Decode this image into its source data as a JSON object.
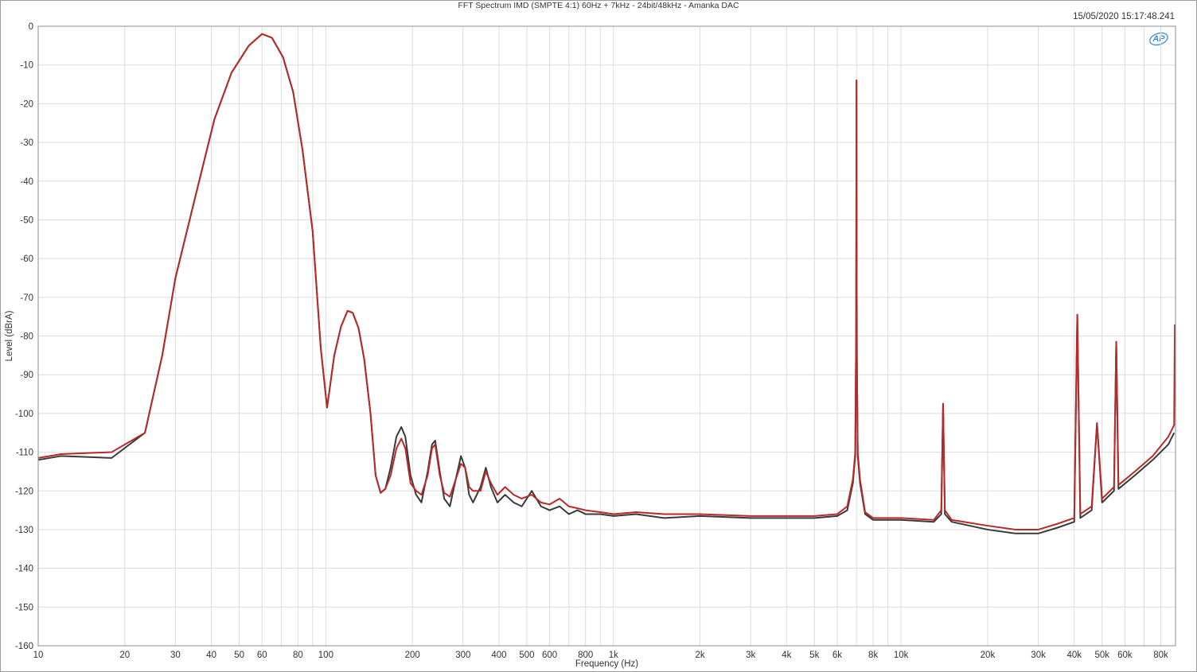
{
  "header": {
    "title": "FFT Spectrum IMD (SMPTE 4:1) 60Hz + 7kHz - 24bit/48kHz - Amanka DAC",
    "timestamp": "15/05/2020 15:17:48.241",
    "logo_text": "AP"
  },
  "chart_data": {
    "type": "line",
    "title": "FFT Spectrum IMD (SMPTE 4:1) 60Hz + 7kHz - 24bit/48kHz - Amanka DAC",
    "xlabel": "Frequency (Hz)",
    "ylabel": "Level (dBrA)",
    "x_scale": "log",
    "xlim": [
      10,
      90000
    ],
    "ylim": [
      -160,
      0
    ],
    "grid": true,
    "x_ticks": [
      {
        "value": 10,
        "label": "10"
      },
      {
        "value": 20,
        "label": "20"
      },
      {
        "value": 30,
        "label": "30"
      },
      {
        "value": 40,
        "label": "40"
      },
      {
        "value": 50,
        "label": "50"
      },
      {
        "value": 60,
        "label": "60"
      },
      {
        "value": 80,
        "label": "80"
      },
      {
        "value": 100,
        "label": "100"
      },
      {
        "value": 200,
        "label": "200"
      },
      {
        "value": 300,
        "label": "300"
      },
      {
        "value": 400,
        "label": "400"
      },
      {
        "value": 500,
        "label": "500"
      },
      {
        "value": 600,
        "label": "600"
      },
      {
        "value": 800,
        "label": "800"
      },
      {
        "value": 1000,
        "label": "1k"
      },
      {
        "value": 2000,
        "label": "2k"
      },
      {
        "value": 3000,
        "label": "3k"
      },
      {
        "value": 4000,
        "label": "4k"
      },
      {
        "value": 5000,
        "label": "5k"
      },
      {
        "value": 6000,
        "label": "6k"
      },
      {
        "value": 8000,
        "label": "8k"
      },
      {
        "value": 10000,
        "label": "10k"
      },
      {
        "value": 20000,
        "label": "20k"
      },
      {
        "value": 30000,
        "label": "30k"
      },
      {
        "value": 40000,
        "label": "40k"
      },
      {
        "value": 50000,
        "label": "50k"
      },
      {
        "value": 60000,
        "label": "60k"
      },
      {
        "value": 80000,
        "label": "80k"
      }
    ],
    "y_ticks": [
      0,
      -10,
      -20,
      -30,
      -40,
      -50,
      -60,
      -70,
      -80,
      -90,
      -100,
      -110,
      -120,
      -130,
      -140,
      -150,
      -160
    ],
    "series": [
      {
        "color": "#3a3a3a",
        "points": [
          [
            10,
            -112
          ],
          [
            12,
            -111
          ],
          [
            18,
            -111.5
          ],
          [
            23.5,
            -105
          ],
          [
            27,
            -85
          ],
          [
            30,
            -65
          ],
          [
            36,
            -41
          ],
          [
            41,
            -24
          ],
          [
            47,
            -12
          ],
          [
            54,
            -5
          ],
          [
            60,
            -2
          ],
          [
            65,
            -3
          ],
          [
            71,
            -8
          ],
          [
            77,
            -17
          ],
          [
            83,
            -32
          ],
          [
            90,
            -53
          ],
          [
            96,
            -83
          ],
          [
            101,
            -98.5
          ],
          [
            107,
            -85
          ],
          [
            113,
            -77.5
          ],
          [
            119,
            -73.5
          ],
          [
            124,
            -74
          ],
          [
            130,
            -78
          ],
          [
            136,
            -86
          ],
          [
            143,
            -100
          ],
          [
            149,
            -116
          ],
          [
            155,
            -120.5
          ],
          [
            161,
            -119.5
          ],
          [
            168,
            -114
          ],
          [
            176,
            -106
          ],
          [
            183,
            -103.5
          ],
          [
            189,
            -106
          ],
          [
            197,
            -116
          ],
          [
            206,
            -121
          ],
          [
            215,
            -123
          ],
          [
            226,
            -115
          ],
          [
            234,
            -108
          ],
          [
            240,
            -107
          ],
          [
            249,
            -115
          ],
          [
            258,
            -122
          ],
          [
            270,
            -124
          ],
          [
            283,
            -117
          ],
          [
            295,
            -111
          ],
          [
            305,
            -114
          ],
          [
            315,
            -121
          ],
          [
            325,
            -123
          ],
          [
            345,
            -119
          ],
          [
            360,
            -114
          ],
          [
            375,
            -119
          ],
          [
            395,
            -123
          ],
          [
            420,
            -121
          ],
          [
            450,
            -123
          ],
          [
            480,
            -124
          ],
          [
            520,
            -120
          ],
          [
            560,
            -124
          ],
          [
            600,
            -125
          ],
          [
            650,
            -124
          ],
          [
            700,
            -126
          ],
          [
            750,
            -125
          ],
          [
            800,
            -126
          ],
          [
            900,
            -126
          ],
          [
            1000,
            -126.5
          ],
          [
            1200,
            -126
          ],
          [
            1500,
            -127
          ],
          [
            2000,
            -126.5
          ],
          [
            3000,
            -127
          ],
          [
            4000,
            -127
          ],
          [
            5000,
            -127
          ],
          [
            6000,
            -126.5
          ],
          [
            6500,
            -125
          ],
          [
            6800,
            -118
          ],
          [
            6930,
            -111
          ],
          [
            6980,
            -80
          ],
          [
            7000,
            -14
          ],
          [
            7020,
            -85
          ],
          [
            7070,
            -111
          ],
          [
            7200,
            -118
          ],
          [
            7500,
            -126
          ],
          [
            8000,
            -127.5
          ],
          [
            10000,
            -127.5
          ],
          [
            13000,
            -128
          ],
          [
            13800,
            -126
          ],
          [
            14000,
            -97.5
          ],
          [
            14200,
            -126
          ],
          [
            15000,
            -128
          ],
          [
            20000,
            -130
          ],
          [
            25000,
            -131
          ],
          [
            30000,
            -131
          ],
          [
            35000,
            -129.5
          ],
          [
            40000,
            -128
          ],
          [
            41000,
            -74.5
          ],
          [
            42000,
            -127
          ],
          [
            46000,
            -125
          ],
          [
            48000,
            -102.5
          ],
          [
            50000,
            -123
          ],
          [
            55000,
            -120
          ],
          [
            56000,
            -81.5
          ],
          [
            57000,
            -119.5
          ],
          [
            65000,
            -116
          ],
          [
            75000,
            -112
          ],
          [
            85000,
            -108
          ],
          [
            89000,
            -105
          ]
        ]
      },
      {
        "color": "#b72a2a",
        "points": [
          [
            10,
            -111.5
          ],
          [
            12,
            -110.5
          ],
          [
            18,
            -110
          ],
          [
            23.5,
            -105
          ],
          [
            27,
            -85
          ],
          [
            30,
            -65
          ],
          [
            36,
            -41
          ],
          [
            41,
            -24
          ],
          [
            47,
            -12
          ],
          [
            54,
            -5
          ],
          [
            60,
            -2
          ],
          [
            65,
            -3
          ],
          [
            71,
            -8
          ],
          [
            77,
            -17
          ],
          [
            83,
            -32
          ],
          [
            90,
            -53
          ],
          [
            96,
            -83
          ],
          [
            101,
            -98.5
          ],
          [
            107,
            -85
          ],
          [
            113,
            -77.5
          ],
          [
            119,
            -73.5
          ],
          [
            124,
            -74
          ],
          [
            130,
            -78
          ],
          [
            136,
            -86
          ],
          [
            143,
            -100
          ],
          [
            149,
            -116
          ],
          [
            155,
            -120.5
          ],
          [
            161,
            -119.5
          ],
          [
            168,
            -116
          ],
          [
            176,
            -109
          ],
          [
            183,
            -106.5
          ],
          [
            189,
            -109
          ],
          [
            197,
            -118
          ],
          [
            206,
            -120
          ],
          [
            215,
            -121
          ],
          [
            226,
            -116
          ],
          [
            234,
            -109
          ],
          [
            240,
            -108
          ],
          [
            249,
            -116
          ],
          [
            258,
            -120.5
          ],
          [
            270,
            -121.5
          ],
          [
            283,
            -117
          ],
          [
            295,
            -113
          ],
          [
            305,
            -114
          ],
          [
            315,
            -119
          ],
          [
            325,
            -120
          ],
          [
            345,
            -120
          ],
          [
            360,
            -115
          ],
          [
            375,
            -118
          ],
          [
            395,
            -121
          ],
          [
            420,
            -119
          ],
          [
            450,
            -121
          ],
          [
            480,
            -122
          ],
          [
            520,
            -121
          ],
          [
            560,
            -123
          ],
          [
            600,
            -123.5
          ],
          [
            650,
            -122
          ],
          [
            700,
            -124
          ],
          [
            750,
            -124.5
          ],
          [
            800,
            -125
          ],
          [
            900,
            -125.5
          ],
          [
            1000,
            -126
          ],
          [
            1200,
            -125.5
          ],
          [
            1500,
            -126
          ],
          [
            2000,
            -126
          ],
          [
            3000,
            -126.5
          ],
          [
            4000,
            -126.5
          ],
          [
            5000,
            -126.5
          ],
          [
            6000,
            -126
          ],
          [
            6500,
            -124
          ],
          [
            6800,
            -117
          ],
          [
            6930,
            -110
          ],
          [
            6980,
            -79
          ],
          [
            7000,
            -14
          ],
          [
            7020,
            -84
          ],
          [
            7070,
            -110
          ],
          [
            7200,
            -117
          ],
          [
            7500,
            -125.5
          ],
          [
            8000,
            -127
          ],
          [
            10000,
            -127
          ],
          [
            13000,
            -127.5
          ],
          [
            13800,
            -125
          ],
          [
            14000,
            -97.5
          ],
          [
            14200,
            -125
          ],
          [
            15000,
            -127.5
          ],
          [
            20000,
            -129
          ],
          [
            25000,
            -130
          ],
          [
            30000,
            -130
          ],
          [
            35000,
            -128.5
          ],
          [
            40000,
            -127
          ],
          [
            41000,
            -74.5
          ],
          [
            42000,
            -126
          ],
          [
            46000,
            -124
          ],
          [
            48000,
            -102.5
          ],
          [
            50000,
            -122
          ],
          [
            55000,
            -119
          ],
          [
            56000,
            -81.5
          ],
          [
            57000,
            -118.5
          ],
          [
            65000,
            -115
          ],
          [
            75000,
            -111
          ],
          [
            85000,
            -106
          ],
          [
            89000,
            -103
          ],
          [
            89500,
            -77
          ]
        ]
      }
    ]
  }
}
